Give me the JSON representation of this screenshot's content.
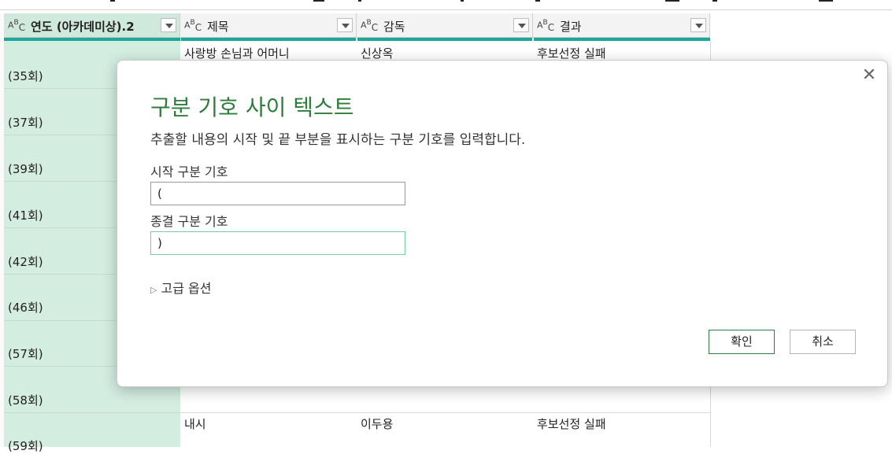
{
  "grid": {
    "columns": [
      {
        "type_icon": "ABC",
        "title": "연도 (아카데미상).2"
      },
      {
        "type_icon": "ABC",
        "title": "제목"
      },
      {
        "type_icon": "ABC",
        "title": "감독"
      },
      {
        "type_icon": "ABC",
        "title": "결과"
      }
    ],
    "year_cells": [
      "(35회)",
      "(37회)",
      "(39회)",
      "(41회)",
      "(42회)",
      "(46회)",
      "(57회)",
      "(58회)",
      "(59회)"
    ],
    "top_row": {
      "title": "사랑방 손님과 어머니",
      "director": "신상옥",
      "result": "후보선정 실패"
    },
    "bottom_row": {
      "title": "내시",
      "director": "이두용",
      "result": "후보선정 실패"
    }
  },
  "dialog": {
    "title": "구분 기호 사이 텍스트",
    "description": "추출할 내용의 시작 및 끝 부분을 표시하는 구분 기호를 입력합니다.",
    "start_label": "시작 구분 기호",
    "start_value": "(",
    "end_label": "종결 구분 기호",
    "end_value": ")",
    "advanced_label": "고급 옵션",
    "ok_label": "확인",
    "cancel_label": "취소",
    "close_glyph": "✕"
  },
  "colors": {
    "accent": "#2e7d3a",
    "teal": "#1aa89a",
    "selected_column": "#d3ede1"
  }
}
